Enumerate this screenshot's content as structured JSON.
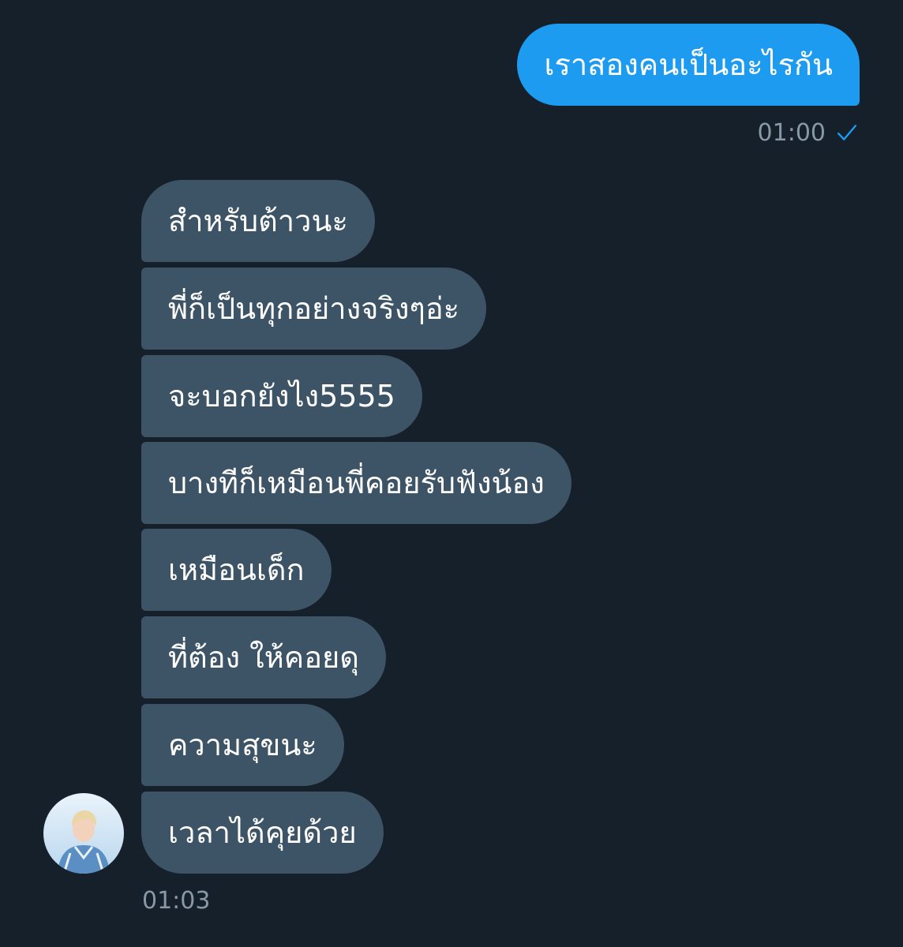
{
  "outgoing": {
    "message": "เราสองคนเป็นอะไรกัน",
    "time": "01:00",
    "status_icon": "check-icon"
  },
  "incoming": {
    "messages": [
      "สำหรับต้าวนะ",
      "พี่ก็เป็นทุกอย่างจริงๆอ่ะ",
      "จะบอกยังไง5555",
      "บางทีก็เหมือนพี่คอยรับฟังน้อง",
      "เหมือนเด็ก",
      "ที่ต้อง ให้คอยดุ",
      "ความสุขนะ",
      "เวลาได้คุยด้วย"
    ],
    "time": "01:03"
  },
  "colors": {
    "background": "#16202b",
    "outgoing_bubble": "#1d9bf0",
    "incoming_bubble": "#3d5466",
    "meta_text": "#8899a6"
  }
}
